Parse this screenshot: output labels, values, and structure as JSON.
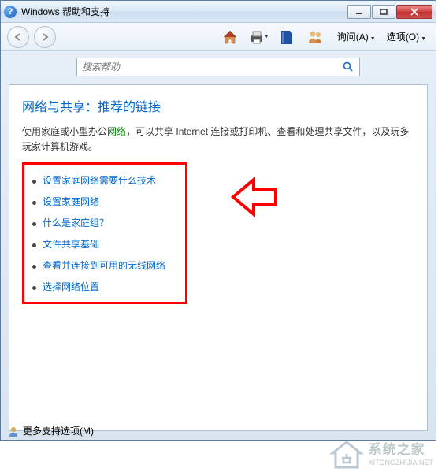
{
  "titlebar": {
    "title": "Windows 帮助和支持"
  },
  "toolbar": {
    "ask_label": "询问(A)",
    "options_label": "选项(O)"
  },
  "search": {
    "placeholder": "搜索帮助"
  },
  "content": {
    "heading": "网络与共享：推荐的链接",
    "intro_before": "使用家庭或小型办公",
    "intro_link": "网络",
    "intro_after": "，可以共享 Internet 连接或打印机、查看和处理共享文件，以及玩多玩家计算机游戏。",
    "links": [
      "设置家庭网络需要什么技术",
      "设置家庭网络",
      "什么是家庭组？",
      "文件共享基础",
      "查看并连接到可用的无线网络",
      "选择网络位置"
    ]
  },
  "footer": {
    "more_options": "更多支持选项(M)"
  },
  "watermark": {
    "name": "系统之家",
    "url": "XITONGZHIJIA.NET"
  }
}
